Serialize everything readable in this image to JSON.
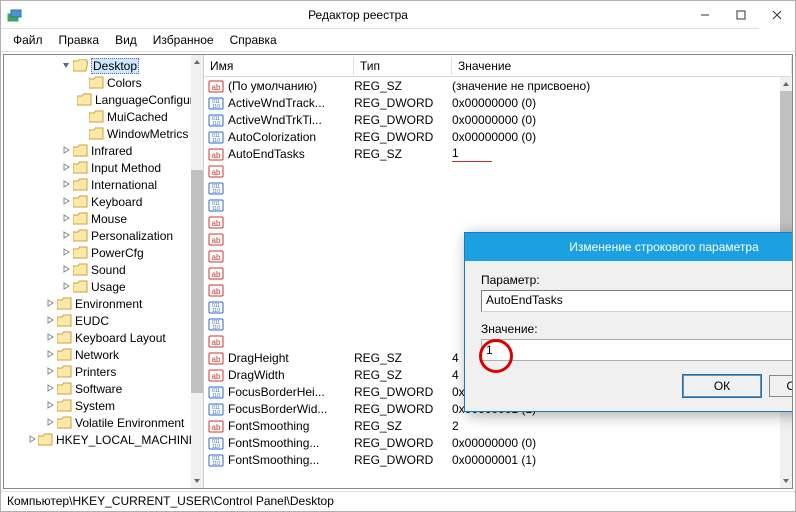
{
  "window": {
    "title": "Редактор реестра"
  },
  "menu": [
    "Файл",
    "Правка",
    "Вид",
    "Избранное",
    "Справка"
  ],
  "tree": [
    {
      "depth": "d4",
      "exp": "open",
      "sel": true,
      "label": "Desktop",
      "kind": "open"
    },
    {
      "depth": "d5",
      "exp": "none",
      "label": "Colors"
    },
    {
      "depth": "d5",
      "exp": "none",
      "label": "LanguageConfiguration"
    },
    {
      "depth": "d5",
      "exp": "none",
      "label": "MuiCached"
    },
    {
      "depth": "d5",
      "exp": "none",
      "label": "WindowMetrics"
    },
    {
      "depth": "d4",
      "exp": "closed",
      "label": "Infrared"
    },
    {
      "depth": "d4",
      "exp": "closed",
      "label": "Input Method"
    },
    {
      "depth": "d4",
      "exp": "closed",
      "label": "International"
    },
    {
      "depth": "d4",
      "exp": "closed",
      "label": "Keyboard"
    },
    {
      "depth": "d4",
      "exp": "closed",
      "label": "Mouse"
    },
    {
      "depth": "d4",
      "exp": "closed",
      "label": "Personalization"
    },
    {
      "depth": "d4",
      "exp": "closed",
      "label": "PowerCfg"
    },
    {
      "depth": "d4",
      "exp": "closed",
      "label": "Sound"
    },
    {
      "depth": "d4",
      "exp": "closed",
      "label": "Usage"
    },
    {
      "depth": "d3",
      "exp": "closed",
      "label": "Environment"
    },
    {
      "depth": "d3",
      "exp": "closed",
      "label": "EUDC"
    },
    {
      "depth": "d3",
      "exp": "closed",
      "label": "Keyboard Layout"
    },
    {
      "depth": "d3",
      "exp": "closed",
      "label": "Network"
    },
    {
      "depth": "d3",
      "exp": "closed",
      "label": "Printers"
    },
    {
      "depth": "d3",
      "exp": "closed",
      "label": "Software"
    },
    {
      "depth": "d3",
      "exp": "closed",
      "label": "System"
    },
    {
      "depth": "d3",
      "exp": "closed",
      "label": "Volatile Environment"
    },
    {
      "depth": "d2",
      "exp": "closed",
      "label": "HKEY_LOCAL_MACHINE"
    }
  ],
  "columns": {
    "name": "Имя",
    "type": "Тип",
    "value": "Значение"
  },
  "rows": [
    {
      "icon": "ab",
      "name": "(По умолчанию)",
      "type": "REG_SZ",
      "value": "(значение не присвоено)"
    },
    {
      "icon": "bin",
      "name": "ActiveWndTrack...",
      "type": "REG_DWORD",
      "value": "0x00000000 (0)"
    },
    {
      "icon": "bin",
      "name": "ActiveWndTrkTi...",
      "type": "REG_DWORD",
      "value": "0x00000000 (0)"
    },
    {
      "icon": "bin",
      "name": "AutoColorization",
      "type": "REG_DWORD",
      "value": "0x00000000 (0)"
    },
    {
      "icon": "ab",
      "name": "AutoEndTasks",
      "type": "REG_SZ",
      "value": "1",
      "mark": true
    },
    {
      "icon": "ab",
      "name": "",
      "type": "",
      "value": ""
    },
    {
      "icon": "bin",
      "name": "",
      "type": "",
      "value": ""
    },
    {
      "icon": "bin",
      "name": "",
      "type": "",
      "value": ""
    },
    {
      "icon": "ab",
      "name": "",
      "type": "",
      "value": ""
    },
    {
      "icon": "ab",
      "name": "",
      "type": "",
      "value": ""
    },
    {
      "icon": "ab",
      "name": "",
      "type": "",
      "value": ""
    },
    {
      "icon": "ab",
      "name": "",
      "type": "",
      "value": ""
    },
    {
      "icon": "ab",
      "name": "",
      "type": "",
      "value": ""
    },
    {
      "icon": "bin",
      "name": "",
      "type": "",
      "value": ""
    },
    {
      "icon": "bin",
      "name": "",
      "type": "",
      "value": ""
    },
    {
      "icon": "ab",
      "name": "",
      "type": "",
      "value": ""
    },
    {
      "icon": "ab",
      "name": "DragHeight",
      "type": "REG_SZ",
      "value": "4"
    },
    {
      "icon": "ab",
      "name": "DragWidth",
      "type": "REG_SZ",
      "value": "4"
    },
    {
      "icon": "bin",
      "name": "FocusBorderHei...",
      "type": "REG_DWORD",
      "value": "0x00000001 (1)"
    },
    {
      "icon": "bin",
      "name": "FocusBorderWid...",
      "type": "REG_DWORD",
      "value": "0x00000001 (1)"
    },
    {
      "icon": "ab",
      "name": "FontSmoothing",
      "type": "REG_SZ",
      "value": "2"
    },
    {
      "icon": "bin",
      "name": "FontSmoothing...",
      "type": "REG_DWORD",
      "value": "0x00000000 (0)"
    },
    {
      "icon": "bin",
      "name": "FontSmoothing...",
      "type": "REG_DWORD",
      "value": "0x00000001 (1)"
    }
  ],
  "dialog": {
    "title": "Изменение строкового параметра",
    "param_label": "Параметр:",
    "param_value": "AutoEndTasks",
    "value_label": "Значение:",
    "value_value": "1",
    "ok": "ОК",
    "cancel": "Отмена"
  },
  "statusbar": "Компьютер\\HKEY_CURRENT_USER\\Control Panel\\Desktop"
}
